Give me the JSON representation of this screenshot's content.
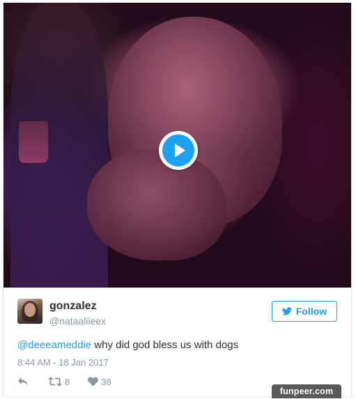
{
  "tweet": {
    "display_name": "gonzalez",
    "handle": "@nataaliieex",
    "follow_label": "Follow",
    "text_mention": "@deeeameddie",
    "text_body": " why did god bless us with dogs",
    "timestamp": "8:44 AM - 18 Jan 2017",
    "retweet_count": "8",
    "like_count": "38"
  },
  "media": {
    "type": "gif-video",
    "play_icon": "play-icon"
  },
  "icons": {
    "follow": "twitter-bird-icon",
    "reply": "reply-icon",
    "retweet": "retweet-icon",
    "like": "heart-icon"
  },
  "watermark": {
    "text": "funpeer.com"
  },
  "colors": {
    "accent": "#1da1f2",
    "text": "#292f33",
    "muted": "#8899a6",
    "border": "#e1e8ed",
    "watermark_bg": "#5a5a5a"
  }
}
